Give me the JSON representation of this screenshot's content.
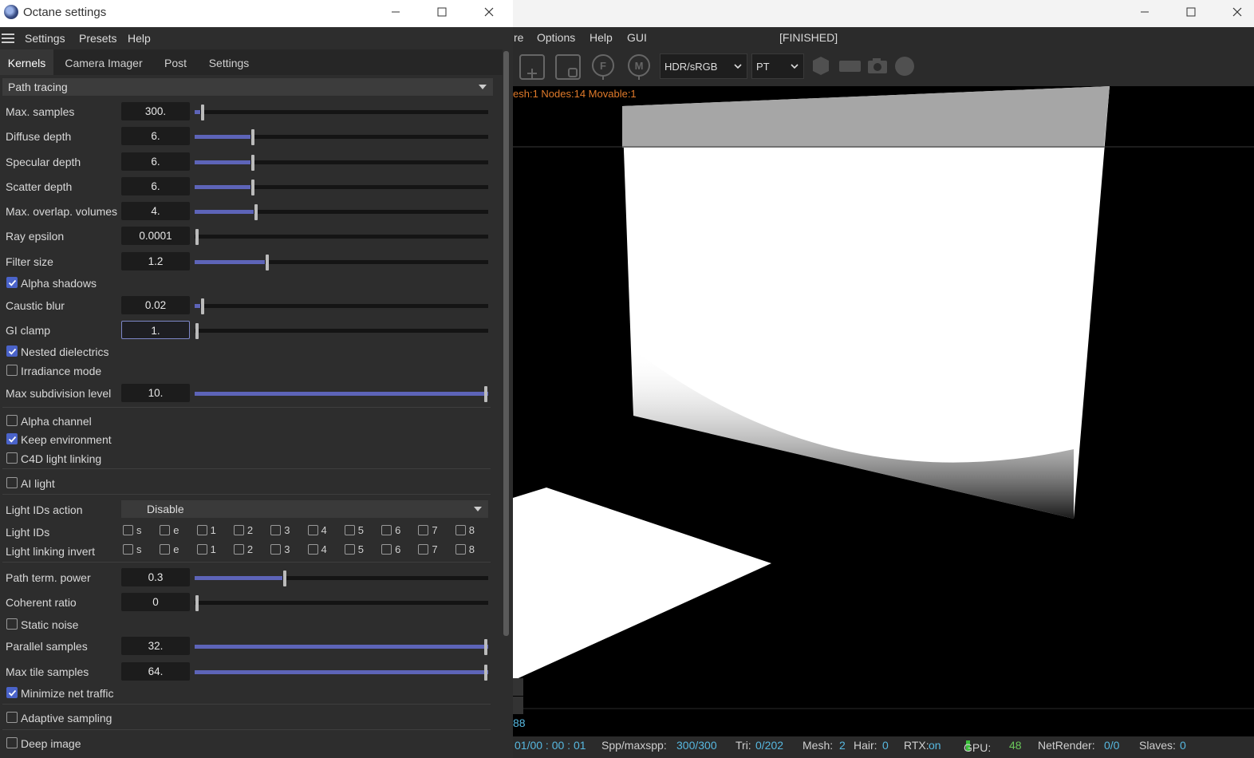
{
  "settings_window": {
    "title": "Octane settings",
    "menu": [
      "Settings",
      "Presets",
      "Help"
    ],
    "tabs": [
      "Kernels",
      "Camera Imager",
      "Post",
      "Settings"
    ],
    "active_tab": "Kernels",
    "kernel": "Path tracing",
    "sliders": [
      {
        "label": "Max. samples",
        "value": "300.",
        "fraction": 0.02
      },
      {
        "label": "Diffuse depth",
        "value": "6.",
        "fraction": 0.19
      },
      {
        "label": "Specular depth",
        "value": "6.",
        "fraction": 0.19
      },
      {
        "label": "Scatter depth",
        "value": "6.",
        "fraction": 0.19
      },
      {
        "label": "Max. overlap. volumes",
        "value": "4.",
        "fraction": 0.2
      },
      {
        "label": "Ray epsilon",
        "value": "0.0001",
        "fraction": 0.0
      },
      {
        "label": "Filter size",
        "value": "1.2",
        "fraction": 0.24
      }
    ],
    "alpha_shadows": {
      "label": "Alpha shadows",
      "checked": true
    },
    "sliders2": [
      {
        "label": "Caustic blur",
        "value": "0.02",
        "fraction": 0.02
      },
      {
        "label": "GI clamp",
        "value": "1.",
        "fraction": 0.0
      }
    ],
    "checks1": [
      {
        "label": "Nested dielectrics",
        "checked": true
      },
      {
        "label": "Irradiance mode",
        "checked": false
      }
    ],
    "max_subdivision": {
      "label": "Max subdivision level",
      "value": "10.",
      "fraction": 1.0
    },
    "checks2": [
      {
        "label": "Alpha channel",
        "checked": false
      },
      {
        "label": "Keep environment",
        "checked": true
      },
      {
        "label": "C4D light linking",
        "checked": false
      }
    ],
    "ai_light": {
      "label": "AI light",
      "checked": false
    },
    "light_ids_action": {
      "label": "Light IDs action",
      "value": "Disable"
    },
    "light_ids": {
      "label": "Light IDs",
      "options": [
        "s",
        "e",
        "1",
        "2",
        "3",
        "4",
        "5",
        "6",
        "7",
        "8"
      ]
    },
    "light_linking_invert": {
      "label": "Light linking invert",
      "options": [
        "s",
        "e",
        "1",
        "2",
        "3",
        "4",
        "5",
        "6",
        "7",
        "8"
      ]
    },
    "sliders3": [
      {
        "label": "Path term. power",
        "value": "0.3",
        "fraction": 0.3
      },
      {
        "label": "Coherent ratio",
        "value": "0",
        "fraction": 0.0
      }
    ],
    "static_noise": {
      "label": "Static noise",
      "checked": false
    },
    "sliders4": [
      {
        "label": "Parallel samples",
        "value": "32.",
        "fraction": 1.0
      },
      {
        "label": "Max tile samples",
        "value": "64.",
        "fraction": 1.0
      }
    ],
    "minimize_net_traffic": {
      "label": "Minimize net traffic",
      "checked": true
    },
    "adaptive_sampling": {
      "label": "Adaptive sampling",
      "checked": false
    },
    "deep_image": {
      "label": "Deep image",
      "checked": false
    }
  },
  "viewer_window": {
    "menu": [
      "re",
      "Options",
      "Help",
      "GUI"
    ],
    "status_label": "[FINISHED]",
    "toolbar_icons": [
      "add-icon",
      "region-icon",
      "focus-pick-icon",
      "material-pick-icon"
    ],
    "color_space": "HDR/sRGB",
    "kernel_short": "PT",
    "info_line": "esh:1 Nodes:14 Movable:1",
    "side_value": "88",
    "status": {
      "time": "01/00 : 00 : 01",
      "spp_label": "Spp/maxspp:",
      "spp_value": "300/300",
      "tri_label": "Tri:",
      "tri_value": "0/202",
      "mesh_label": "Mesh:",
      "mesh_value": "2",
      "hair_label": "Hair:",
      "hair_value": "0",
      "rtx_label": "RTX:",
      "rtx_value": "on",
      "gpu_label": "GPU:",
      "gpu_value": "48",
      "netrender_label": "NetRender:",
      "netrender_value": "0/0",
      "slaves_label": "Slaves:",
      "slaves_value": "0"
    }
  }
}
